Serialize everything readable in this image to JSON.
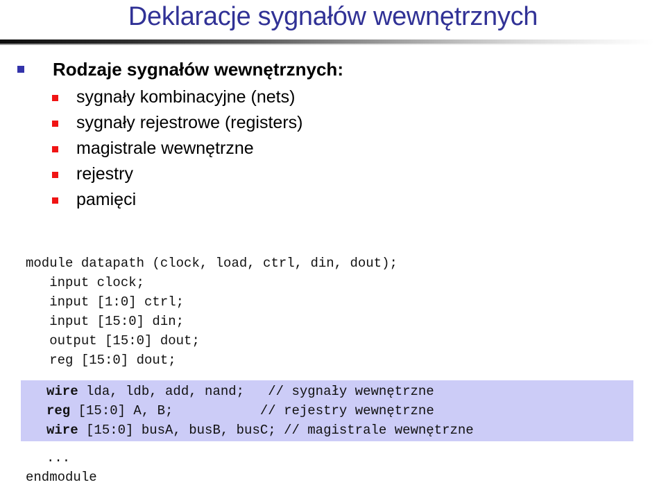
{
  "slide": {
    "title": "Deklaracje sygnałów wewnętrznych",
    "title_color": "#313296",
    "background_color": "#ffffff",
    "highlight_color": "#ccccf7",
    "bullet_level1_color": "#3333aa",
    "bullet_level2_color": "#f01414"
  },
  "bullets": [
    {
      "level": 1,
      "text": "Rodzaje sygnałów wewnętrznych:",
      "marker": "blue-square-bullet-icon"
    },
    {
      "level": 2,
      "text": "sygnały kombinacyjne (nets)",
      "marker": "red-square-bullet-icon"
    },
    {
      "level": 2,
      "text": "sygnały rejestrowe (registers)",
      "marker": "red-square-bullet-icon"
    },
    {
      "level": 2,
      "text": "magistrale wewnętrzne",
      "marker": "red-square-bullet-icon"
    },
    {
      "level": 2,
      "text": "rejestry",
      "marker": "red-square-bullet-icon"
    },
    {
      "level": 2,
      "text": "pamięci",
      "marker": "red-square-bullet-icon"
    }
  ],
  "code": {
    "lines_before": [
      "module datapath (clock, load, ctrl, din, dout);",
      "   input clock;",
      "   input [1:0] ctrl;",
      "   input [15:0] din;",
      "   output [15:0] dout;",
      "   reg [15:0] dout;"
    ],
    "highlighted_lines": [
      {
        "keyword": "wire",
        "code": " lda, ldb, add, nand;   ",
        "comment": "// sygnały wewnętrzne"
      },
      {
        "keyword": "reg",
        "code": " [15:0] A, B;           ",
        "comment": "// rejestry wewnętrzne"
      },
      {
        "keyword": "wire",
        "code": " [15:0] busA, busB, busC; ",
        "comment": "// magistrale wewnętrzne"
      }
    ],
    "lines_after": [
      "...",
      "endmodule"
    ]
  }
}
